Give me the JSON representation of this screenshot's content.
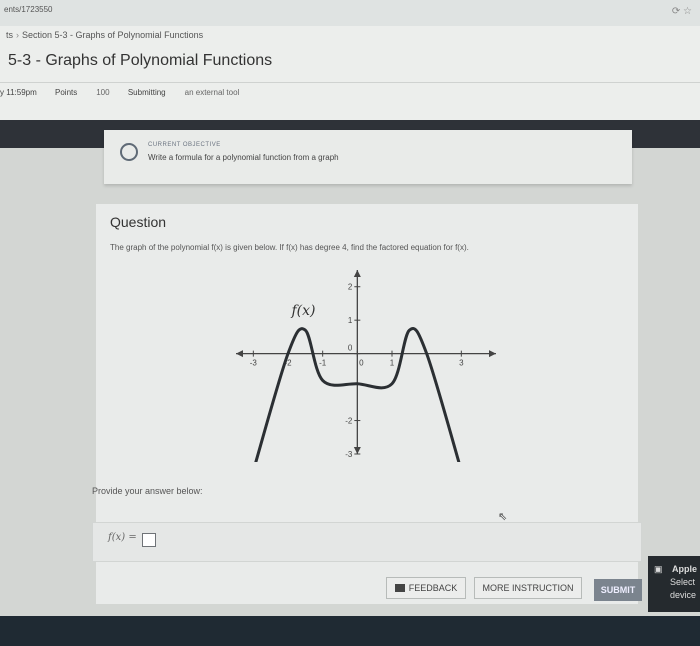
{
  "browser": {
    "url": "ents/1723550"
  },
  "breadcrumb": {
    "prefix": "ts",
    "section": "Section 5-3 - Graphs of Polynomial Functions"
  },
  "page": {
    "title": "5-3 - Graphs of Polynomial Functions"
  },
  "meta": {
    "due": "y 11:59pm",
    "points_label": "Points",
    "points_value": "100",
    "submitting_label": "Submitting",
    "submitting_value": "an external tool"
  },
  "objective": {
    "label": "CURRENT OBJECTIVE",
    "text": "Write a formula for a polynomial function from a graph"
  },
  "question": {
    "heading": "Question",
    "text": "The graph of the polynomial f(x) is given below. If f(x) has degree 4, find the factored equation for f(x).",
    "answer_prompt": "Provide your answer below:",
    "answer_label": "f(x) ="
  },
  "graph": {
    "function_label": "f(x)",
    "x_tick_labels": [
      "-3",
      "-2",
      "-1",
      "0",
      "1",
      "3"
    ],
    "y_tick_labels": [
      "2",
      "1",
      "0",
      "-2",
      "-3"
    ]
  },
  "chart_data": {
    "type": "line",
    "series": [
      {
        "x": [
          -3,
          -2,
          -1.5,
          -1,
          0,
          1,
          1.5,
          2,
          3
        ],
        "y": [
          -3.5,
          0,
          0.7,
          -0.8,
          -0.9,
          -0.9,
          0.7,
          0,
          -3.5
        ]
      }
    ],
    "xlim": [
      -3.5,
      4
    ],
    "ylim": [
      -3,
      2.5
    ]
  },
  "buttons": {
    "feedback": "FEEDBACK",
    "more_instruction": "MORE INSTRUCTION",
    "submit": "SUBMIT"
  },
  "notification": {
    "title": "Apple",
    "line2": "Select",
    "line3": "device"
  },
  "colors": {
    "submit": "#7b848e",
    "dark_band": "#2e3238",
    "curve": "#2b2f33"
  }
}
